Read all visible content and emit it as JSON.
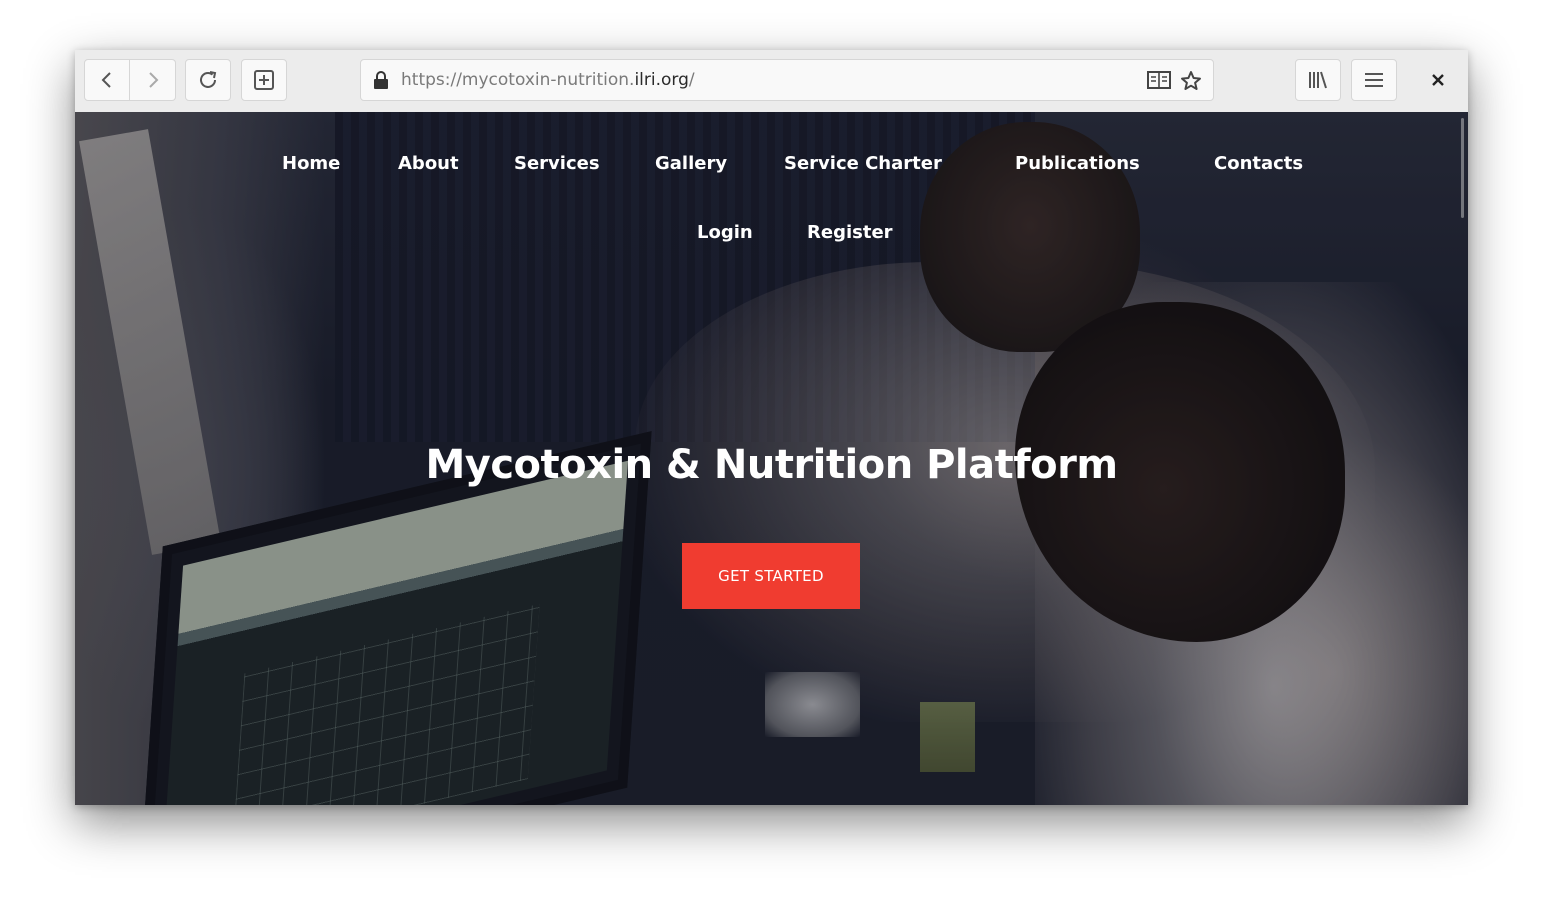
{
  "browser": {
    "url_prefix": "https://mycotoxin-nutrition.",
    "url_domain": "ilri.org",
    "url_suffix": "/"
  },
  "icons": {
    "back": "back-arrow-icon",
    "forward": "forward-arrow-icon",
    "reload": "reload-icon",
    "new_tab": "new-tab-icon",
    "lock": "lock-icon",
    "reader": "reader-view-icon",
    "bookmark": "star-icon",
    "library": "library-icon",
    "menu": "hamburger-menu-icon",
    "close": "close-icon"
  },
  "nav": {
    "items": [
      "Home",
      "About",
      "Services",
      "Gallery",
      "Service Charter",
      "Publications",
      "Contacts",
      "Login",
      "Register"
    ]
  },
  "hero": {
    "title": "Mycotoxin & Nutrition Platform",
    "cta_label": "GET STARTED"
  },
  "colors": {
    "cta_background": "#f03c30",
    "nav_text": "#ffffff"
  }
}
